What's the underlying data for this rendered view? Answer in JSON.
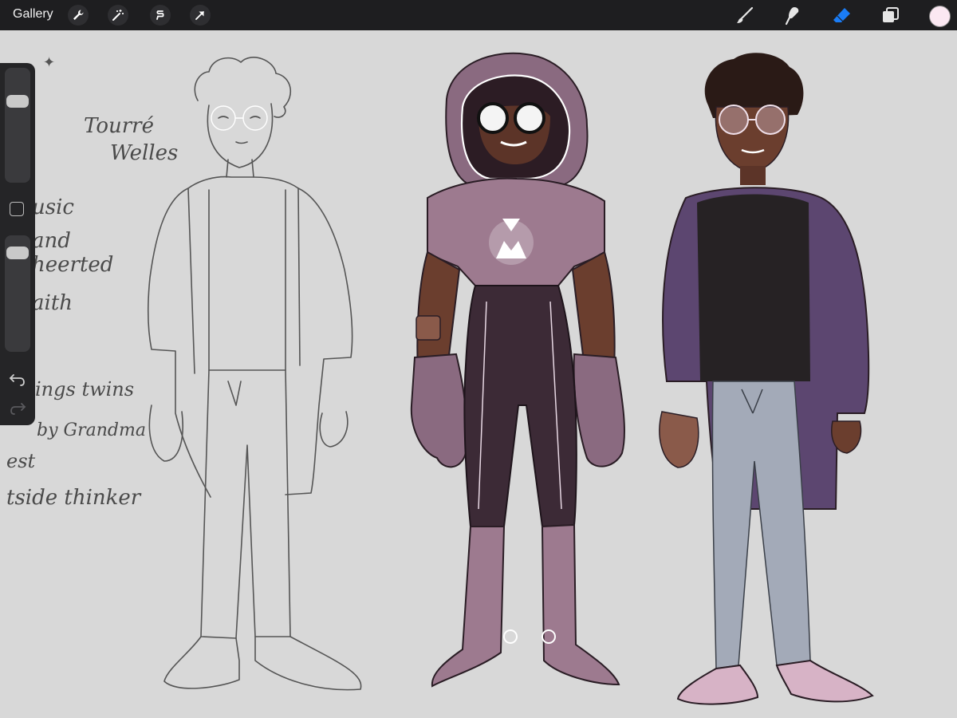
{
  "app": {
    "gallery_label": "Gallery"
  },
  "toolbar": {
    "left_tools": [
      "wrench-icon",
      "magic-wand-icon",
      "selection-icon",
      "transform-arrow-icon"
    ],
    "right_tools": [
      "brush-icon",
      "smudge-icon",
      "eraser-icon",
      "layers-icon"
    ],
    "active_tool": "eraser-icon",
    "accent_color": "#1a7cf5",
    "current_color": "#fbe8f2"
  },
  "sidebar": {
    "brush_size_level": 0.75,
    "opacity_level": 0.92,
    "controls": [
      "brush-size-slider",
      "modify-button",
      "opacity-slider",
      "undo-button",
      "redo-button"
    ]
  },
  "canvas": {
    "notes": {
      "line1": "Tourré",
      "line2": "Welles",
      "line3": "usic",
      "line4": "and",
      "line5": "heerted",
      "line6": "aith",
      "line7": "ings twins",
      "line8": "by Grandma",
      "line9": "est",
      "line10": "tside thinker"
    },
    "colors": {
      "background": "#d8d8d8",
      "suit_dark": "#3c2a36",
      "suit_light": "#9d7a8f",
      "skin": "#6b3e2e",
      "jacket": "#5c4670",
      "shirt": "#262224",
      "pants": "#a3aab8",
      "shoes": "#d7b3c6",
      "glow": "#ffffff"
    }
  }
}
